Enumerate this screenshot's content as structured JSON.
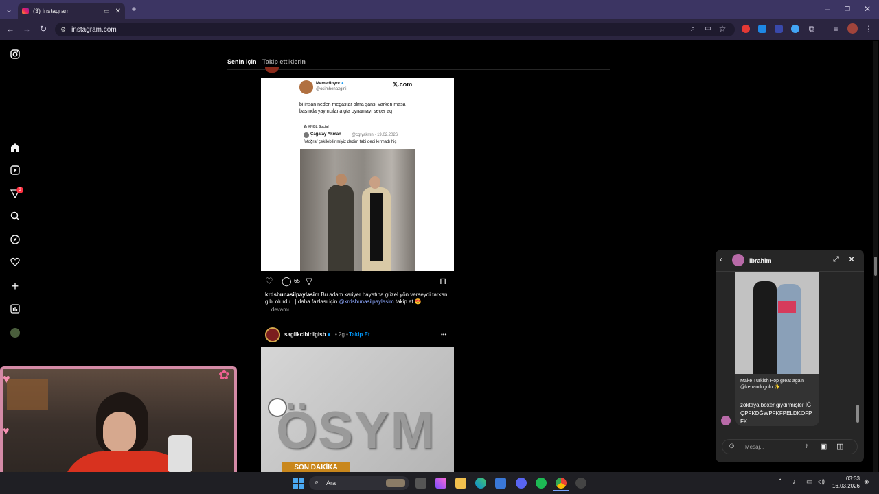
{
  "browser": {
    "tab_title": "(3) Instagram",
    "url": "instagram.com"
  },
  "feed": {
    "tabs": [
      "Senin için",
      "Takip ettiklerin"
    ],
    "notification_badge": "3"
  },
  "post1": {
    "tweet_name": "Memedinyor",
    "tweet_handle": "@osimhenazgini",
    "tweet_source": "𝕏.com",
    "tweet_text": "bi insan neden megastar olma şansı varken masa başında yayıncılarla gta oynamayı seçer aq",
    "quote_source": "KNGL Social",
    "quote_name": "Çağatay Akman",
    "quote_handle_date": "@cgtyakmn · 19.02.2026",
    "quote_text": "fotoğraf çekilebilir miyiz dedim tabi dedi kırmadı hiç",
    "comment_count": "65",
    "caption_user": "krdsbunasilpaylasim",
    "caption_text": "Bu adam kariyer hayatına güzel yön verseydi tarkan gibi olurdu.. | daha fazlası için",
    "caption_mention": "@krdsbunasilpaylasim",
    "caption_tail": "takip et 😍",
    "more": "... devamı"
  },
  "post2": {
    "user": "saglikcibirligisb",
    "time": "• 2g •",
    "follow": "Takip Et",
    "more_icon": "•••",
    "image_text": "ÖSYM",
    "banner": "SON DAKİKA"
  },
  "dm": {
    "name": "ibrahim",
    "shared_caption": "Make Turkish Pop great again @kenandogulu ✨",
    "message": "zoktaya boxer giydirmişler İĞQPFKDĞWPFKFPELDKOFPFK",
    "placeholder": "Mesaj..."
  },
  "taskbar": {
    "search": "Ara",
    "time": "03:33",
    "date": "16.03.2026"
  },
  "colors": {
    "accent": "#0095f6",
    "mention": "#8ea9ff",
    "chrome_tab": "#3c3563"
  }
}
